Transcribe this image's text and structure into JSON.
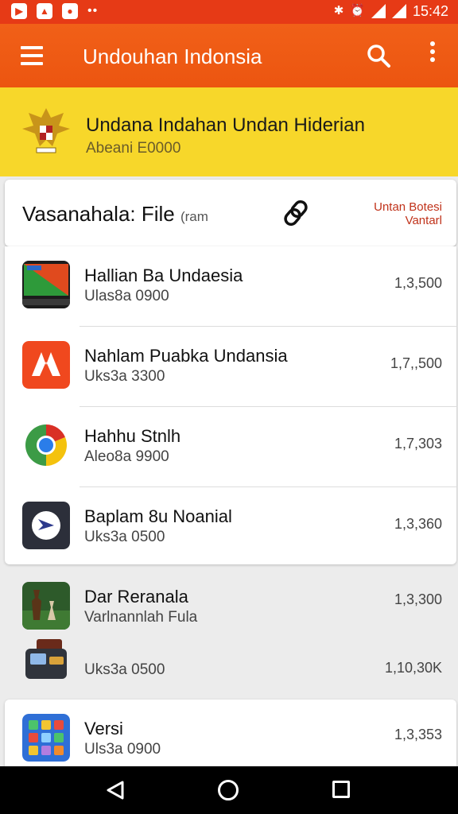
{
  "status_bar": {
    "time": "15:42",
    "dots": "••"
  },
  "app_bar": {
    "title": "Undouhan Indonsia"
  },
  "banner": {
    "title": "Undana Indahan Undan Hiderian",
    "subtitle": "Abeani E0000"
  },
  "header": {
    "label": "Vasanahala: File",
    "label_suffix": "(ram",
    "action_line1": "Untan Botesi",
    "action_line2": "Vantarl"
  },
  "list": [
    {
      "title": "Hallian Ba Undaesia",
      "subtitle": "Ulas8a 0900",
      "value": "1,3,500",
      "icon": "flag-card-icon"
    },
    {
      "title": "Nahlam Puabka Undansia",
      "subtitle": "Uks3a 3300",
      "value": "1,7,,500",
      "icon": "orange-tent-icon"
    },
    {
      "title": "Hahhu Stnlh",
      "subtitle": "Aleo8a 9900",
      "value": "1,7,303",
      "icon": "chrome-like-icon"
    },
    {
      "title": "Baplam 8u Noanial",
      "subtitle": "Uks3a 0500",
      "value": "1,3,360",
      "icon": "navigation-arrow-icon"
    }
  ],
  "lower": [
    {
      "title": "Dar Reranala",
      "subtitle": "Varlnannlah Fula",
      "value": "1,3,300",
      "icon": "chess-pieces-icon"
    },
    {
      "title": "",
      "subtitle": "Uks3a 0500",
      "value": "1,10,30K",
      "icon": "wallet-icon"
    },
    {
      "title": "Versi",
      "subtitle": "Uls3a 0900",
      "value": "1,3,353",
      "icon": "app-grid-icon"
    }
  ],
  "colors": {
    "status_bar": "#e63a16",
    "app_bar": "#ec5510",
    "banner": "#f7d72a",
    "accent_red": "#c0321a"
  }
}
